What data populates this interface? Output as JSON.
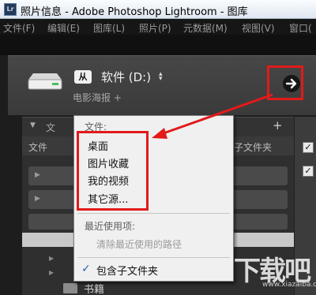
{
  "window": {
    "title": "照片信息 - Adobe Photoshop Lightroom - 图库",
    "app_icon": "Lr"
  },
  "menu": [
    "文件(F)",
    "编辑(E)",
    "图库(L)",
    "照片(P)",
    "元数据(M)",
    "视图(V)",
    "窗口("
  ],
  "catalog": {
    "drive_badge": "从",
    "volume_name": "软件 (D:)",
    "subtitle": "电影海报 +",
    "go_button_icon": "arrow-right-icon"
  },
  "panel": {
    "header_fragment": "文",
    "sub_left": "文件",
    "sub_right": "子文件夹",
    "folder_label": "书籍"
  },
  "dropdown": {
    "section_files": "文件:",
    "items": [
      "桌面",
      "图片收藏",
      "我的视频",
      "其它源..."
    ],
    "section_recent": "最近使用项:",
    "clear_recent": "清除最近使用的路径",
    "include_subfolders": "包含子文件夹",
    "include_subfolders_checked": true
  },
  "watermark": {
    "text": "下载吧",
    "sub": "www.xiazaiba.com"
  },
  "colors": {
    "highlight": "#e21a1a",
    "menu_bg": "#f0f0f0"
  }
}
